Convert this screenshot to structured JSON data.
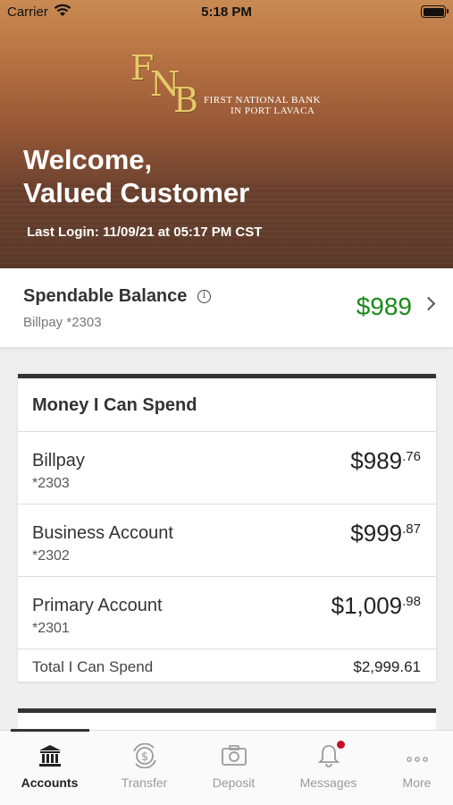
{
  "status_bar": {
    "carrier": "Carrier",
    "time": "5:18 PM"
  },
  "header": {
    "logo_letters": [
      "F",
      "N",
      "B"
    ],
    "bank_name_line1": "First National Bank",
    "bank_name_line2": "In Port Lavaca",
    "welcome_line1": "Welcome,",
    "welcome_line2": "Valued Customer",
    "last_login": "Last Login: 11/09/21 at 05:17 PM CST"
  },
  "spendable": {
    "title": "Spendable Balance",
    "info_glyph": "i",
    "account": "Billpay *2303",
    "amount": "$989",
    "amount_color": "#1a8a1a"
  },
  "money_card": {
    "title": "Money I Can Spend",
    "accounts": [
      {
        "name": "Billpay",
        "number": "*2303",
        "amount_main": "$989",
        "amount_cents": ".76"
      },
      {
        "name": "Business Account",
        "number": "*2302",
        "amount_main": "$999",
        "amount_cents": ".87"
      },
      {
        "name": "Primary Account",
        "number": "*2301",
        "amount_main": "$1,009",
        "amount_cents": ".98"
      }
    ],
    "total_label": "Total I Can Spend",
    "total_value": "$2,999.61"
  },
  "tabs": [
    {
      "label": "Accounts",
      "icon": "bank-icon",
      "active": true
    },
    {
      "label": "Transfer",
      "icon": "transfer-icon",
      "active": false
    },
    {
      "label": "Deposit",
      "icon": "camera-icon",
      "active": false
    },
    {
      "label": "Messages",
      "icon": "bell-icon",
      "active": false,
      "badge_color": "#c4102a"
    },
    {
      "label": "More",
      "icon": "more-icon",
      "active": false
    }
  ]
}
